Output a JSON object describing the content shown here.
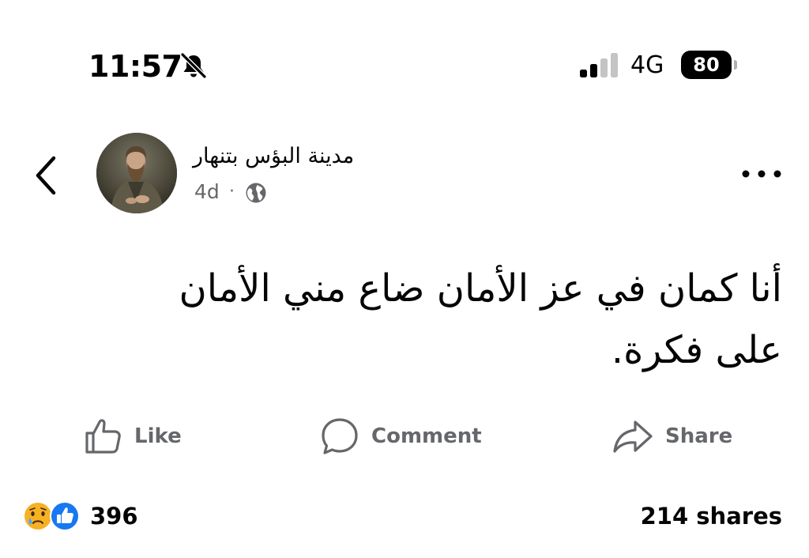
{
  "status_bar": {
    "time": "11:57",
    "network": "4G",
    "battery": "80",
    "icons": [
      "bell-slash-icon",
      "signal-bars-icon",
      "battery-icon"
    ]
  },
  "post": {
    "author": "مدينة البؤس بتنهار",
    "time": "4d",
    "separator": "·",
    "privacy_icon": "globe-icon",
    "text_lines": [
      "أنا كمان في عز الأمان ضاع مني الأمان",
      "على فكرة."
    ]
  },
  "actions": {
    "like": "Like",
    "comment": "Comment",
    "share": "Share"
  },
  "engagement": {
    "reaction_icons": [
      "sad-reaction-icon",
      "like-reaction-icon"
    ],
    "reaction_count": "396",
    "shares": "214 shares"
  },
  "colors": {
    "text": "#050505",
    "secondary_text": "#65676b",
    "like_blue": "#1877f2",
    "sad_yellow": "#f7b125"
  }
}
